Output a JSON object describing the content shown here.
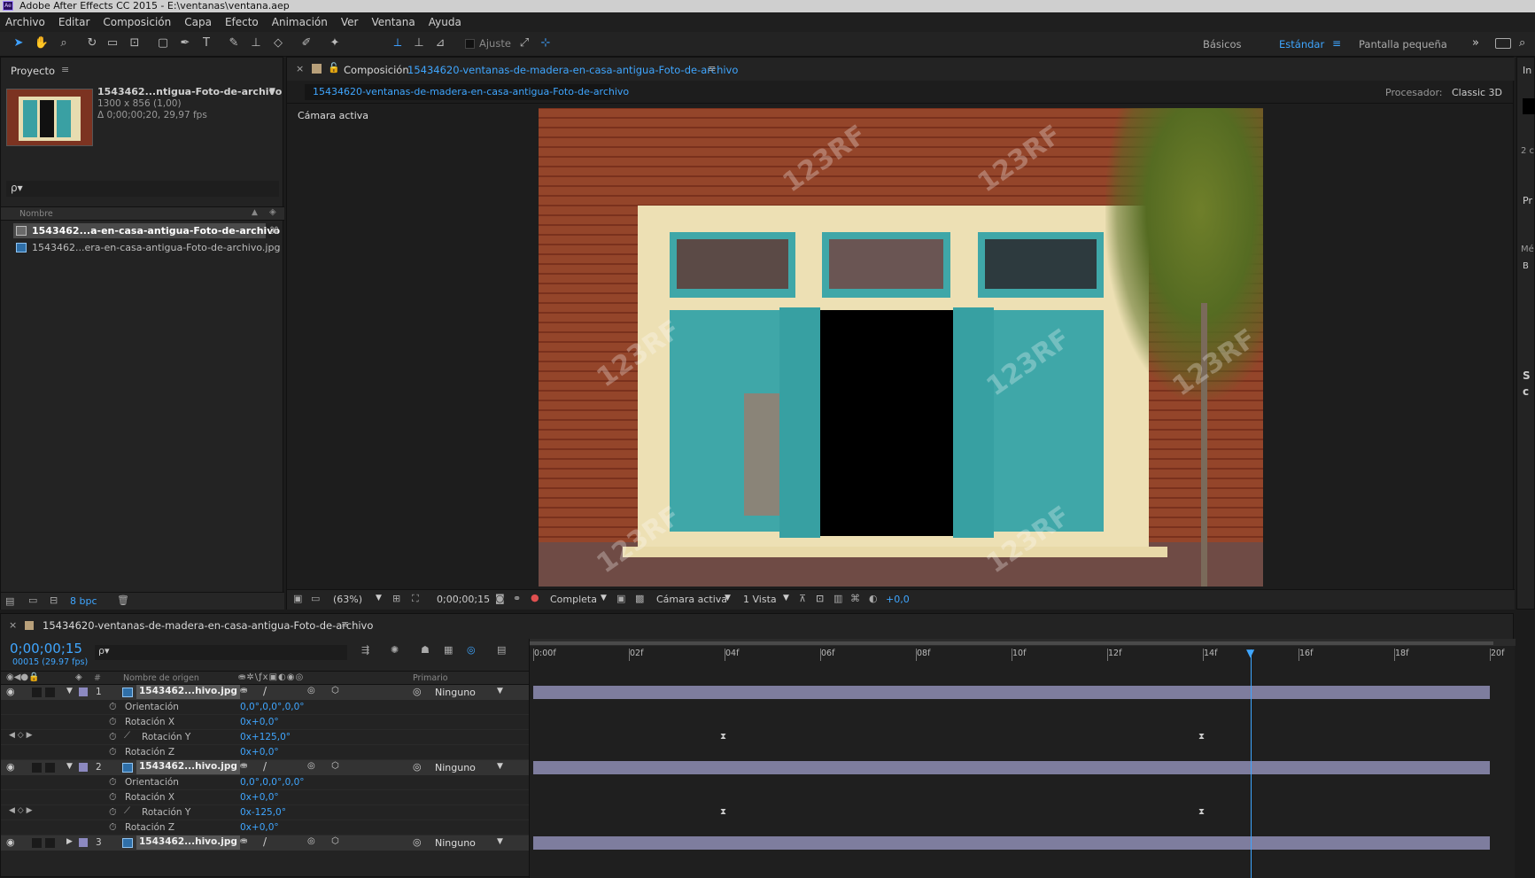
{
  "titlebar": {
    "text": "Adobe After Effects CC 2015 - E:\\ventanas\\ventana.aep",
    "icon": "Ae"
  },
  "menu": [
    "Archivo",
    "Editar",
    "Composición",
    "Capa",
    "Efecto",
    "Animación",
    "Ver",
    "Ventana",
    "Ayuda"
  ],
  "toolbar": {
    "snap_label": "Ajuste",
    "workspaces": [
      "Básicos",
      "Estándar",
      "Pantalla pequeña"
    ]
  },
  "project": {
    "title": "Proyecto",
    "item_name": "1543462...ntigua-Foto-de-archivo",
    "item_dims": "1300 x 856 (1,00)",
    "item_duration": "Δ 0;00;00;20, 29,97 fps",
    "search_placeholder": "ρ▾",
    "column_name": "Nombre",
    "items": [
      "1543462...a-en-casa-antigua-Foto-de-archivo",
      "1543462...era-en-casa-antigua-Foto-de-archivo.jpg"
    ],
    "bpc": "8 bpc"
  },
  "composition": {
    "panel_label": "Composición",
    "comp_name": "15434620-ventanas-de-madera-en-casa-antigua-Foto-de-archivo",
    "tab": "15434620-ventanas-de-madera-en-casa-antigua-Foto-de-archivo",
    "renderer_label": "Procesador:",
    "renderer": "Classic 3D",
    "camera_label": "Cámara activa",
    "watermark": "123RF",
    "footer": {
      "zoom": "(63%)",
      "timecode": "0;00;00;15",
      "resolution": "Completa",
      "camera": "Cámara activa",
      "views": "1 Vista",
      "exposure": "+0,0"
    }
  },
  "right_panel": {
    "labels": [
      "In",
      "2 c",
      "Pr",
      "Mé",
      "B",
      "S",
      "c"
    ]
  },
  "timeline": {
    "tab": "15434620-ventanas-de-madera-en-casa-antigua-Foto-de-archivo",
    "timecode": "0;00;00;15",
    "frame_info": "00015 (29.97 fps)",
    "col_source": "Nombre de origen",
    "col_parent": "Primario",
    "ruler": [
      "0:00f",
      "02f",
      "04f",
      "06f",
      "08f",
      "10f",
      "12f",
      "14f",
      "16f",
      "18f",
      "20f"
    ],
    "layers": [
      {
        "num": "1",
        "name": "1543462...hivo.jpg",
        "parent": "Ninguno",
        "props": [
          {
            "name": "Orientación",
            "value": "0,0°,0,0°,0,0°"
          },
          {
            "name": "Rotación X",
            "value": "0x+0,0°"
          },
          {
            "name": "Rotación Y",
            "value": "0x+125,0°"
          },
          {
            "name": "Rotación Z",
            "value": "0x+0,0°"
          }
        ]
      },
      {
        "num": "2",
        "name": "1543462...hivo.jpg",
        "parent": "Ninguno",
        "props": [
          {
            "name": "Orientación",
            "value": "0,0°,0,0°,0,0°"
          },
          {
            "name": "Rotación X",
            "value": "0x+0,0°"
          },
          {
            "name": "Rotación Y",
            "value": "0x-125,0°"
          },
          {
            "name": "Rotación Z",
            "value": "0x+0,0°"
          }
        ]
      },
      {
        "num": "3",
        "name": "1543462...hivo.jpg",
        "parent": "Ninguno",
        "props": []
      }
    ],
    "keyframes_frames": [
      4,
      14
    ],
    "current_frame": 15,
    "total_frames": 20
  },
  "colors": {
    "accent": "#3fa6ff",
    "brick": "#8a3a22",
    "teal": "#3fa7a8",
    "cream": "#ede0b4",
    "playhead": "#3fa6ff"
  }
}
